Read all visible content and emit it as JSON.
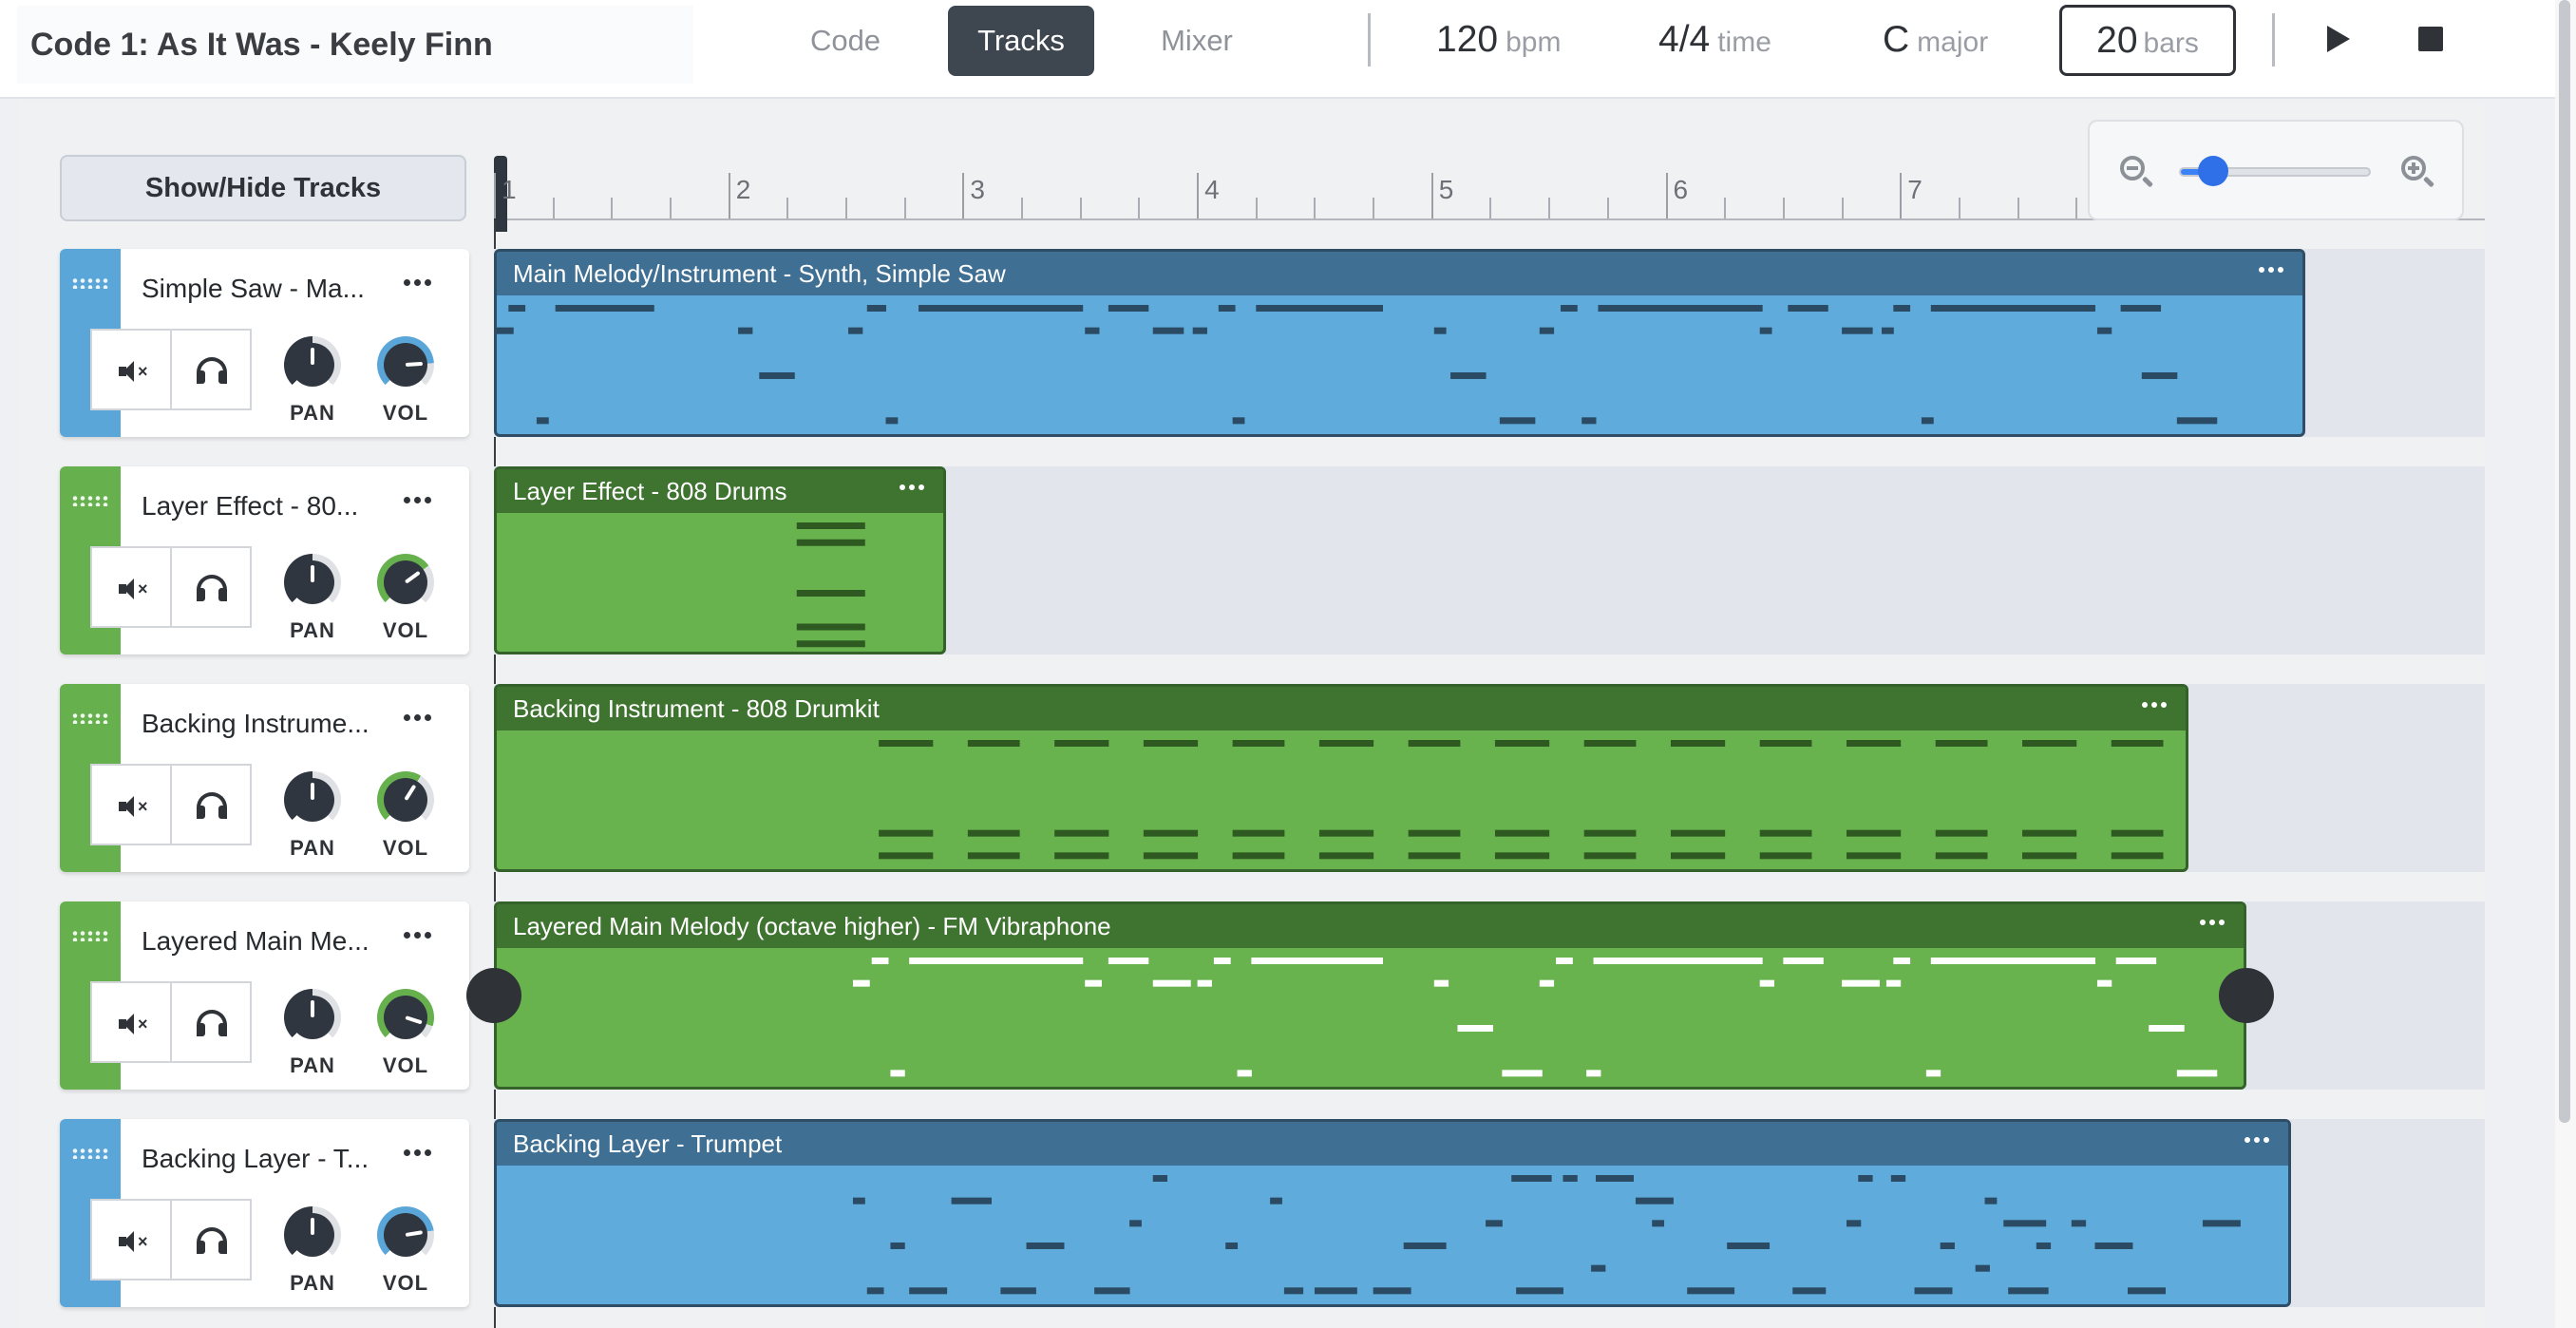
{
  "project": {
    "title": "Code 1: As It Was - Keely Finn"
  },
  "tabs": [
    {
      "label": "Code",
      "active": false
    },
    {
      "label": "Tracks",
      "active": true
    },
    {
      "label": "Mixer",
      "active": false
    }
  ],
  "transport": {
    "tempo_value": "120",
    "tempo_unit": "bpm",
    "time_sig_value": "4/4",
    "time_sig_unit": "time",
    "key_value": "C",
    "key_unit": "major",
    "bars_value": "20",
    "bars_unit": "bars",
    "play_icon": "play-icon",
    "stop_icon": "stop-icon"
  },
  "sidebar": {
    "show_hide_label": "Show/Hide Tracks"
  },
  "ruler": {
    "bars": [
      "1",
      "2",
      "3",
      "4",
      "5",
      "6",
      "7"
    ]
  },
  "zoom": {
    "level": 0.18,
    "zoom_out_icon": "zoom-out-icon",
    "zoom_in_icon": "zoom-in-icon"
  },
  "colors": {
    "blue_strip": "#5ba6d9",
    "blue_clip": "#5fabdb",
    "blue_clip_head": "#3f6f93",
    "blue_clip_border": "#2f4e66",
    "blue_note": "#2b4a63",
    "green_strip": "#66b14d",
    "green_clip": "#68b34e",
    "green_clip_head": "#3f7330",
    "green_clip_border": "#35612a",
    "green_note": "#2e5a22",
    "green_note_light": "#ffffff",
    "knob_ring_grey": "#dfe1e5"
  },
  "tracks": [
    {
      "name": "Simple Saw - Ma...",
      "color": "blue",
      "pan_label": "PAN",
      "vol_label": "VOL",
      "pan": 0.5,
      "vol": 0.82,
      "clip": {
        "title": "Main Melody/Instrument - Synth, Simple Saw",
        "bars_span": 7.73,
        "note_style": "dark",
        "rows": [
          [
            [
              0.05,
              0.13
            ],
            [
              0.25,
              0.68
            ],
            [
              1.58,
              1.67
            ],
            [
              1.8,
              2.51
            ],
            [
              2.61,
              2.79
            ],
            [
              3.08,
              3.16
            ],
            [
              3.24,
              3.79
            ],
            [
              4.54,
              4.62
            ],
            [
              4.7,
              5.41
            ],
            [
              5.51,
              5.69
            ],
            [
              5.96,
              6.04
            ],
            [
              6.12,
              6.83
            ],
            [
              6.93,
              7.11
            ]
          ],
          [
            [
              0.0,
              0.08
            ],
            [
              1.03,
              1.1
            ],
            [
              1.5,
              1.57
            ],
            [
              2.51,
              2.58
            ],
            [
              2.8,
              2.94
            ],
            [
              2.97,
              3.04
            ],
            [
              4.0,
              4.06
            ],
            [
              4.45,
              4.52
            ],
            [
              5.39,
              5.45
            ],
            [
              5.74,
              5.88
            ],
            [
              5.91,
              5.97
            ],
            [
              6.83,
              6.9
            ]
          ],
          [],
          [
            [
              1.12,
              1.28
            ],
            [
              4.07,
              4.23
            ],
            [
              7.02,
              7.18
            ]
          ],
          [],
          [
            [
              0.17,
              0.23
            ],
            [
              1.66,
              1.72
            ],
            [
              3.14,
              3.2
            ],
            [
              4.28,
              4.44
            ],
            [
              4.63,
              4.7
            ],
            [
              6.08,
              6.14
            ],
            [
              7.17,
              7.35
            ]
          ]
        ]
      }
    },
    {
      "name": "Layer Effect - 80...",
      "color": "green",
      "pan_label": "PAN",
      "vol_label": "VOL",
      "pan": 0.5,
      "vol": 0.7,
      "clip": {
        "title": "Layer Effect - 808 Drums",
        "bars_span": 1.93,
        "note_style": "dark",
        "rows": [
          [
            [
              1.28,
              1.58
            ]
          ],
          [
            [
              1.28,
              1.58
            ]
          ],
          [],
          [],
          [
            [
              1.28,
              1.58
            ]
          ],
          [],
          [
            [
              1.28,
              1.58
            ]
          ],
          [
            [
              1.28,
              1.58
            ]
          ]
        ]
      }
    },
    {
      "name": "Backing Instrume...",
      "color": "green",
      "pan_label": "PAN",
      "vol_label": "VOL",
      "pan": 0.5,
      "vol": 0.62,
      "clip": {
        "title": "Backing Instrument - 808 Drumkit",
        "bars_span": 7.23,
        "note_style": "dark",
        "rows": [
          [
            [
              1.63,
              1.87
            ],
            [
              2.01,
              2.24
            ],
            [
              2.38,
              2.62
            ],
            [
              2.76,
              3.0
            ],
            [
              3.14,
              3.37
            ],
            [
              3.51,
              3.75
            ],
            [
              3.89,
              4.12
            ],
            [
              4.26,
              4.5
            ],
            [
              4.64,
              4.87
            ],
            [
              5.01,
              5.25
            ],
            [
              5.39,
              5.62
            ],
            [
              5.76,
              6.0
            ],
            [
              6.14,
              6.37
            ],
            [
              6.51,
              6.75
            ],
            [
              6.89,
              7.12
            ]
          ],
          [],
          [],
          [],
          [
            [
              1.63,
              1.87
            ],
            [
              2.01,
              2.24
            ],
            [
              2.38,
              2.62
            ],
            [
              2.76,
              3.0
            ],
            [
              3.14,
              3.37
            ],
            [
              3.51,
              3.75
            ],
            [
              3.89,
              4.12
            ],
            [
              4.26,
              4.5
            ],
            [
              4.64,
              4.87
            ],
            [
              5.01,
              5.25
            ],
            [
              5.39,
              5.62
            ],
            [
              5.76,
              6.0
            ],
            [
              6.14,
              6.37
            ],
            [
              6.51,
              6.75
            ],
            [
              6.89,
              7.12
            ]
          ],
          [
            [
              1.63,
              1.87
            ],
            [
              2.01,
              2.24
            ],
            [
              2.38,
              2.62
            ],
            [
              2.76,
              3.0
            ],
            [
              3.14,
              3.37
            ],
            [
              3.51,
              3.75
            ],
            [
              3.89,
              4.12
            ],
            [
              4.26,
              4.5
            ],
            [
              4.64,
              4.87
            ],
            [
              5.01,
              5.25
            ],
            [
              5.39,
              5.62
            ],
            [
              5.76,
              6.0
            ],
            [
              6.14,
              6.37
            ],
            [
              6.51,
              6.75
            ],
            [
              6.89,
              7.12
            ]
          ]
        ]
      }
    },
    {
      "name": "Layered Main Me...",
      "color": "green",
      "pan_label": "PAN",
      "vol_label": "VOL",
      "pan": 0.5,
      "vol": 0.9,
      "clip": {
        "title": "Layered Main Melody (octave higher) - FM Vibraphone",
        "bars_span": 7.48,
        "note_style": "light",
        "handles": true,
        "rows": [
          [
            [
              1.6,
              1.68
            ],
            [
              1.76,
              2.51
            ],
            [
              2.61,
              2.79
            ],
            [
              3.06,
              3.14
            ],
            [
              3.22,
              3.79
            ],
            [
              4.52,
              4.6
            ],
            [
              4.68,
              5.41
            ],
            [
              5.49,
              5.67
            ],
            [
              5.96,
              6.04
            ],
            [
              6.12,
              6.83
            ],
            [
              6.91,
              7.09
            ]
          ],
          [
            [
              1.52,
              1.6
            ],
            [
              2.51,
              2.59
            ],
            [
              2.8,
              2.97
            ],
            [
              2.99,
              3.06
            ],
            [
              4.0,
              4.07
            ],
            [
              4.45,
              4.52
            ],
            [
              5.39,
              5.46
            ],
            [
              5.74,
              5.91
            ],
            [
              5.93,
              6.0
            ],
            [
              6.83,
              6.9
            ]
          ],
          [],
          [
            [
              4.1,
              4.26
            ],
            [
              7.05,
              7.21
            ]
          ],
          [],
          [
            [
              1.68,
              1.75
            ],
            [
              3.16,
              3.23
            ],
            [
              4.29,
              4.47
            ],
            [
              4.65,
              4.72
            ],
            [
              6.1,
              6.17
            ],
            [
              7.17,
              7.35
            ]
          ]
        ]
      }
    },
    {
      "name": "Backing Layer - T...",
      "color": "blue",
      "pan_label": "PAN",
      "vol_label": "VOL",
      "pan": 0.5,
      "vol": 0.8,
      "clip": {
        "title": "Backing Layer - Trumpet",
        "bars_span": 7.67,
        "note_style": "dark",
        "rows": [
          [
            [
              2.8,
              2.87
            ],
            [
              4.33,
              4.51
            ],
            [
              4.55,
              4.62
            ],
            [
              4.69,
              4.86
            ],
            [
              5.81,
              5.88
            ],
            [
              5.95,
              6.02
            ]
          ],
          [
            [
              1.52,
              1.58
            ],
            [
              1.94,
              2.12
            ],
            [
              3.3,
              3.36
            ],
            [
              4.86,
              5.03
            ],
            [
              6.35,
              6.41
            ]
          ],
          [
            [
              2.7,
              2.76
            ],
            [
              4.22,
              4.3
            ],
            [
              4.93,
              4.99
            ],
            [
              5.76,
              5.83
            ],
            [
              6.43,
              6.62
            ],
            [
              6.72,
              6.79
            ],
            [
              7.28,
              7.45
            ]
          ],
          [
            [
              1.68,
              1.75
            ],
            [
              2.26,
              2.43
            ],
            [
              3.11,
              3.17
            ],
            [
              3.87,
              4.06
            ],
            [
              5.25,
              5.44
            ],
            [
              6.16,
              6.23
            ],
            [
              6.57,
              6.64
            ],
            [
              6.82,
              6.99
            ]
          ],
          [
            [
              4.67,
              4.74
            ],
            [
              6.31,
              6.38
            ]
          ],
          [
            [
              1.58,
              1.66
            ],
            [
              1.76,
              1.93
            ],
            [
              2.15,
              2.31
            ],
            [
              2.55,
              2.71
            ],
            [
              3.36,
              3.45
            ],
            [
              3.49,
              3.68
            ],
            [
              3.74,
              3.91
            ],
            [
              4.35,
              4.56
            ],
            [
              5.08,
              5.29
            ],
            [
              5.53,
              5.68
            ],
            [
              6.05,
              6.22
            ],
            [
              6.45,
              6.63
            ],
            [
              6.96,
              7.13
            ]
          ]
        ]
      }
    }
  ]
}
